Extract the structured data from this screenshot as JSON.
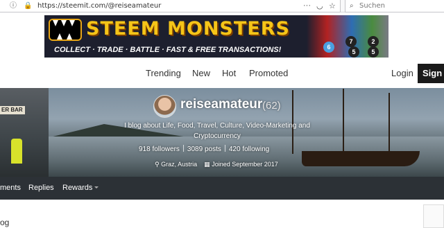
{
  "browser": {
    "url": "https://steemit.com/@reiseamateur",
    "search_placeholder": "Suchen",
    "icons": [
      "info-icon",
      "lock-icon",
      "page-actions-icon",
      "pocket-icon",
      "bookmark-star-icon",
      "search-icon"
    ]
  },
  "ad": {
    "title": "STEEM MONSTERS",
    "subtitle": "COLLECT · TRADE · BATTLE · FAST & FREE TRANSACTIONS!",
    "badges": [
      "6",
      "7",
      "5",
      "2",
      "5"
    ]
  },
  "nav": {
    "items": [
      "Trending",
      "New",
      "Hot",
      "Promoted"
    ],
    "login": "Login",
    "signup": "Sign"
  },
  "profile": {
    "name": "reiseamateur",
    "reputation": "(62)",
    "about": "I blog about Life, Food, Travel, Culture, Video-Marketing and Cryptocurrency",
    "followers": "918 followers",
    "posts": "3089 posts",
    "following": "420 following",
    "location": "Graz, Austria",
    "joined": "Joined September 2017",
    "cover_sign": "ER BAR"
  },
  "subnav": {
    "items": [
      "ments",
      "Replies",
      "Rewards"
    ]
  },
  "below": {
    "text": "og"
  },
  "colors": {
    "ad_title": "#f5c518",
    "subnav_bg": "#2c3136",
    "signup_bg": "#1a1a1a"
  }
}
